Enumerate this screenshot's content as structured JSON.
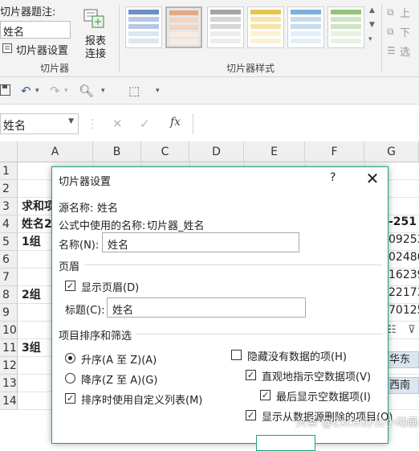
{
  "ribbon": {
    "caption_label": "切片器题注:",
    "caption_value": "姓名",
    "slicer_settings_label": "切片器设置",
    "report_connections_line1": "报表",
    "report_connections_line2": "连接",
    "group_slicer": "切片器",
    "group_styles": "切片器样式",
    "bring_forward": "上",
    "send_backward": "下",
    "selection_pane": "选"
  },
  "namebox": {
    "value": "姓名"
  },
  "formula_bar": {
    "fx_label": "fx",
    "value": ""
  },
  "grid": {
    "columns": [
      "A",
      "B",
      "C",
      "D",
      "E",
      "F",
      "G"
    ],
    "rows": [
      "1",
      "2",
      "3",
      "4",
      "5",
      "6",
      "7",
      "8",
      "9",
      "10",
      "11",
      "12",
      "13",
      "14"
    ],
    "cells": {
      "a3": "求和项",
      "a4": "姓名2",
      "a5": "1组",
      "a8": "2组",
      "a11": "3组",
      "g4": "-251",
      "g5": "09253",
      "g6": "02486",
      "g7": "16239",
      "g8": "22173",
      "g9": "70125"
    },
    "slicer_items": [
      "华东",
      "西南"
    ]
  },
  "dialog": {
    "title": "切片器设置",
    "help": "?",
    "close": "✕",
    "source_name_label": "源名称:",
    "source_name_value": "姓名",
    "formula_name_label": "公式中使用的名称:",
    "formula_name_value": "切片器_姓名",
    "name_label": "名称(N):",
    "name_value": "姓名",
    "header_section": "页眉",
    "show_header_label": "显示页眉(D)",
    "show_header_checked": true,
    "caption_label": "标题(C):",
    "caption_value": "姓名",
    "sort_section": "项目排序和筛选",
    "asc_label": "升序(A 至 Z)(A)",
    "desc_label": "降序(Z 至 A)(G)",
    "sort_selected": "asc",
    "custom_list_label": "排序时使用自定义列表(M)",
    "custom_list_checked": true,
    "hide_no_data_label": "隐藏没有数据的项(H)",
    "hide_no_data_checked": false,
    "visual_no_data_label": "直观地指示空数据项(V)",
    "visual_no_data_checked": true,
    "show_last_label": "最后显示空数据项(I)",
    "show_last_checked": true,
    "show_deleted_label": "显示从数据源删除的项目(O)",
    "show_deleted_checked": true
  },
  "watermark": "头条 @Excel办公小动画",
  "colors": {
    "dialog_border": "#1e9f85",
    "ribbon_bg": "#f3f3f3",
    "slicer_item_bg": "#dce6f1"
  }
}
